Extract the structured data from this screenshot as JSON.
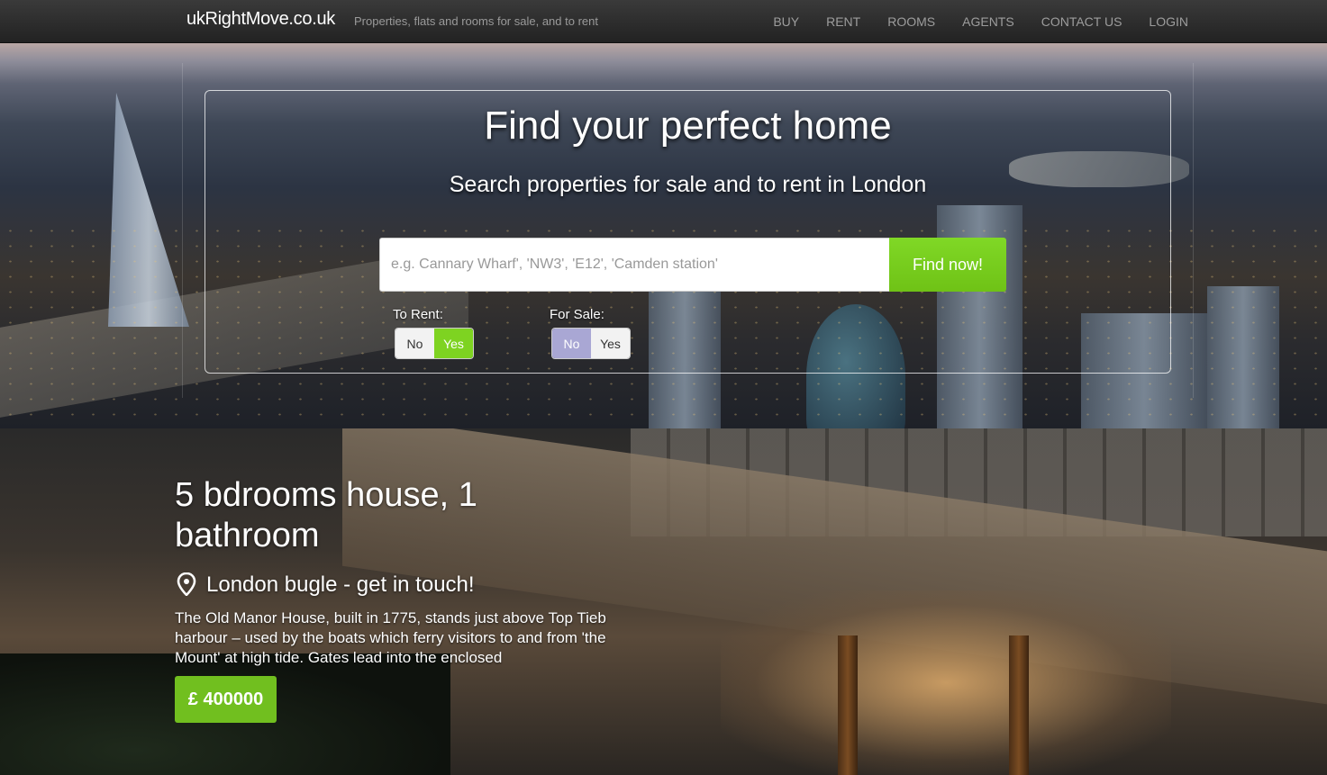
{
  "nav": {
    "brand": "ukRightMove.co.uk",
    "tagline": "Properties, flats and rooms for sale, and to rent",
    "links": [
      "BUY",
      "RENT",
      "ROOMS",
      "AGENTS",
      "CONTACT US",
      "LOGIN"
    ]
  },
  "hero": {
    "title": "Find your perfect home",
    "subtitle": "Search properties for sale and to rent in London",
    "search_placeholder": "e.g. Cannary Wharf', 'NW3', 'E12', 'Camden station'",
    "search_button": "Find now!",
    "to_rent": {
      "label": "To Rent:",
      "no": "No",
      "yes": "Yes",
      "selected": "Yes"
    },
    "for_sale": {
      "label": "For Sale:",
      "no": "No",
      "yes": "Yes",
      "selected": "No"
    }
  },
  "listing": {
    "title": "5 bdrooms house, 1 bathroom",
    "location": "London bugle - get in touch!",
    "description": "The Old Manor House, built in 1775, stands just above Top Tieb harbour – used by the boats which ferry visitors to and from 'the Mount' at high tide. Gates lead into the enclosed",
    "price": "£ 400000"
  },
  "colors": {
    "accent_green": "#7ed321",
    "toggle_purple": "#a9a7d4"
  }
}
